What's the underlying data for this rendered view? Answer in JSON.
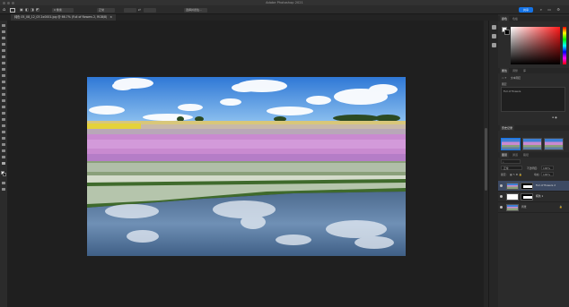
{
  "window": {
    "title": "Adobe Photoshop 2021"
  },
  "options_bar": {
    "feather_value": "0 像素",
    "style_value": "正常",
    "select_mask_label": "选择并遮住...",
    "share_label": "共享"
  },
  "document": {
    "tab_label": "纯色 05_08_12_03 2x0001.jpg @ 66.7% (Full of flowers 2, RGB/8)"
  },
  "panels": {
    "color_tabs": [
      "颜色",
      "色板"
    ],
    "properties_tabs": [
      "属性",
      "调整",
      "库"
    ],
    "properties_header": "文本图层",
    "properties_section": "图层",
    "properties_layer_name": "Full of flowers",
    "history_label": "历史记录",
    "layers_tabs": [
      "图层",
      "通道",
      "路径"
    ],
    "blend_mode": "正常",
    "opacity_label": "不透明度:",
    "opacity_value": "100%",
    "lock_label": "锁定:",
    "fill_label": "填充:",
    "fill_value": "100%",
    "layers": [
      {
        "name": "Full of flowers 2",
        "selected": true
      },
      {
        "name": "纯色 1",
        "selected": false
      },
      {
        "name": "背景",
        "selected": false
      }
    ]
  },
  "colors": {
    "accent": "#1473e6",
    "panel_bg": "#2b2b2b",
    "canvas_bg": "#1f1f1f"
  },
  "icons": [
    "home-icon",
    "marquee-icon",
    "move-icon",
    "eye-icon",
    "lock-icon",
    "search-icon"
  ]
}
